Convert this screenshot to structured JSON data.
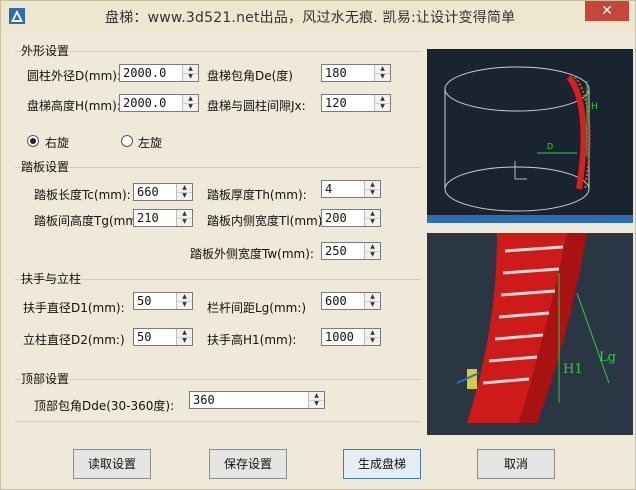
{
  "window": {
    "title": "盘梯：www.3d521.net出品，风过水无痕. 凯易:让设计变得简单",
    "close_label": "✕"
  },
  "outer": {
    "group_label": "外形设置",
    "diameter_label": "圆柱外径D(mm):",
    "diameter_value": "2000.0",
    "wrap_angle_label": "盘梯包角De(度)",
    "wrap_angle_value": "180",
    "height_label": "盘梯高度H(mm):",
    "height_value": "2000.0",
    "gap_label": "盘梯与圆柱间隙Jx:",
    "gap_value": "120",
    "right_label": "右旋",
    "left_label": "左旋"
  },
  "tread": {
    "group_label": "踏板设置",
    "length_label": "踏板长度Tc(mm):",
    "length_value": "660",
    "thickness_label": "踏板厚度Th(mm):",
    "thickness_value": "4",
    "spacing_label": "踏板间高度Tg(mm)",
    "spacing_value": "210",
    "inner_width_label": "踏板内侧宽度Tl(mm):",
    "inner_width_value": "200",
    "outer_width_label": "踏板外侧宽度Tw(mm):",
    "outer_width_value": "250"
  },
  "handrail": {
    "group_label": "扶手与立柱",
    "hand_dia_label": "扶手直径D1(mm):",
    "hand_dia_value": "50",
    "rail_spacing_label": "栏杆间距Lg(mm:)",
    "rail_spacing_value": "600",
    "post_dia_label": "立柱直径D2(mm:)",
    "post_dia_value": "50",
    "hand_height_label": "扶手高H1(mm):",
    "hand_height_value": "1000"
  },
  "top": {
    "group_label": "顶部设置",
    "angle_label": "顶部包角Dde(30-360度):",
    "angle_value": "360"
  },
  "buttons": {
    "read": "读取设置",
    "save": "保存设置",
    "generate": "生成盘梯",
    "cancel": "取消"
  },
  "preview": {
    "top_label_h": "H",
    "top_label_d": "D",
    "bottom_label_h1": "H1",
    "bottom_label_lg": "Lg"
  }
}
